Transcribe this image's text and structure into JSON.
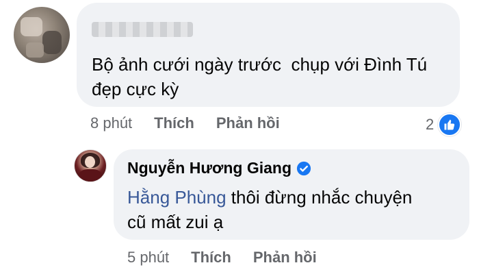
{
  "comments": [
    {
      "text_lines": [
        "Bộ ảnh cưới ngày trước  chụp với Đình Tú",
        "đẹp cực kỳ"
      ],
      "time": "8 phút",
      "like_label": "Thích",
      "reply_label": "Phản hồi",
      "reaction_count": "2",
      "reaction_icon": "like-thumb-icon"
    },
    {
      "author": "Nguyễn Hương Giang",
      "verified_icon": "verified-badge-icon",
      "mention": "Hằng Phùng",
      "text_line1_rest": " thôi đừng nhắc chuyện",
      "text_line2": "cũ mất zui ạ",
      "time": "5 phút",
      "like_label": "Thích",
      "reply_label": "Phản hồi"
    }
  ],
  "colors": {
    "bubble_bg": "#f0f2f5",
    "secondary_text": "#65676b",
    "mention": "#385898",
    "like_blue": "#1877f2"
  }
}
